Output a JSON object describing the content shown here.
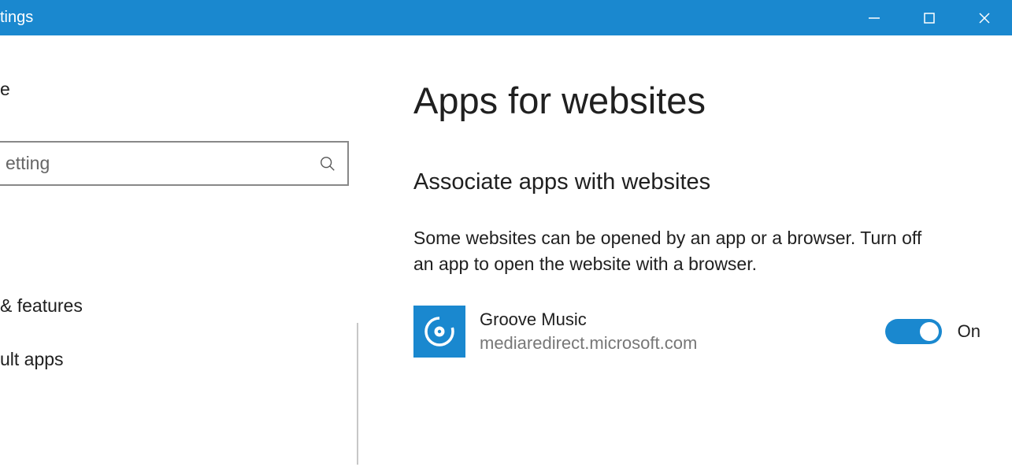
{
  "window": {
    "title": "tings"
  },
  "sidebar": {
    "home": "e",
    "search_placeholder": "etting",
    "items": [
      {
        "label": "& features"
      },
      {
        "label": "ult apps"
      }
    ]
  },
  "main": {
    "heading": "Apps for websites",
    "subheading": "Associate apps with websites",
    "description": "Some websites can be opened by an app or a browser.  Turn off an app to open the website with a browser.",
    "app": {
      "name": "Groove Music",
      "domain": "mediaredirect.microsoft.com",
      "toggle_state": "On"
    }
  }
}
